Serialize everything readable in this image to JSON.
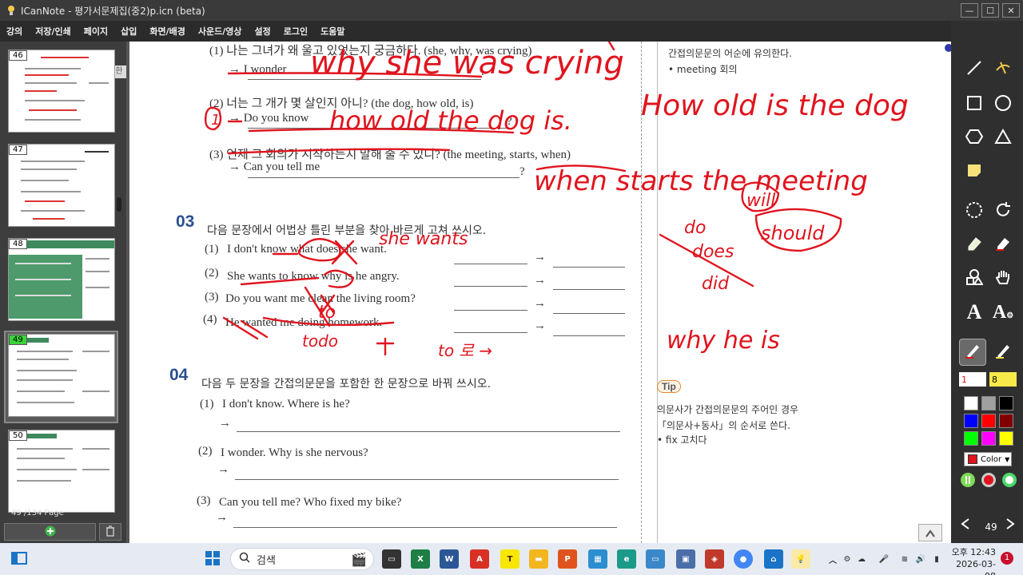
{
  "window": {
    "title": "ICanNote - 평가서문제집(중2)p.icn (beta)"
  },
  "menu": [
    "강의",
    "저장/인쇄",
    "페이지",
    "삽입",
    "화면/배경",
    "사운드/영상",
    "설정",
    "로그인",
    "도움말"
  ],
  "sidebar": {
    "thumbs": [
      {
        "num": "46"
      },
      {
        "num": "47"
      },
      {
        "num": "48"
      },
      {
        "num": "49",
        "current": true
      },
      {
        "num": "50"
      }
    ],
    "han_badge": "한",
    "page_count": "49 /134 Page"
  },
  "document": {
    "top": {
      "q1_korean": "(1) 나는 그녀가 왜 울고 있었는지 궁금하다. (she, why, was crying)",
      "q1_prompt": "→ I wonder",
      "q1_end": ".",
      "q2_korean": "(2) 너는 그 개가 몇 살인지 아니? (the dog, how old, is)",
      "q2_prompt": "→ Do you know",
      "q2_end": "?",
      "q3_korean": "(3) 언제 그 회의가 시작하는지 말해 줄 수 있니? (the meeting, starts, when)",
      "q3_prompt": "→ Can you tell me",
      "q3_end": "?"
    },
    "section03": {
      "num": "03",
      "instruction": "다음 문장에서 어법상 틀린 부분을 찾아 바르게 고쳐 쓰시오.",
      "items": [
        {
          "num": "(1)",
          "text": "I don't know what does she want."
        },
        {
          "num": "(2)",
          "text": "She wants to know why is he angry."
        },
        {
          "num": "(3)",
          "text": "Do you want me clean the living room?"
        },
        {
          "num": "(4)",
          "text": "He wanted me doing homework."
        }
      ],
      "arrow": "→"
    },
    "section04": {
      "num": "04",
      "instruction": "다음 두 문장을 간접의문문을 포함한 한 문장으로 바꿔 쓰시오.",
      "items": [
        {
          "num": "(1)",
          "text": "I don't know. Where is he?"
        },
        {
          "num": "(2)",
          "text": "I wonder. Why is she nervous?"
        },
        {
          "num": "(3)",
          "text": "Can you tell me? Who fixed my bike?"
        }
      ],
      "arrow": "→"
    },
    "side_notes": {
      "note1": "간접의문문의 어순에 유의한다.",
      "note2": "• meeting  회의",
      "tip_label": "Tip",
      "tip1": "의문사가 간접의문문의 주어인 경우",
      "tip2": "「의문사+동사」의 순서로 쓴다.",
      "tip3": "• fix  고치다"
    },
    "handwriting": {
      "a1": "why she was crying",
      "a2a": "how old the dog is.",
      "a2b": "How old is the dog",
      "a3": "when starts the meeting",
      "w1": "she wants",
      "w_do": "do",
      "w_does": "does",
      "w_did": "did",
      "w_will": "will",
      "w_should": "should",
      "w_to": "to",
      "w_todo": "todo",
      "w_towhy": "why he is",
      "w_toro": "to 로 →",
      "w_q1": "1"
    }
  },
  "toolbar": {
    "pen_size": "1",
    "marker_size": "8",
    "color_label": "Color",
    "page_number": "49"
  },
  "taskbar": {
    "search_placeholder": "검색",
    "clock_time": "오후 12:43",
    "clock_date": "2026-03-08",
    "notif_count": "1"
  },
  "colors": {
    "ink_red": "#e0141e",
    "title_blue": "#2b4f8f",
    "swatches": [
      "#ffffff",
      "#a0a0a0",
      "#000000",
      "#0000ff",
      "#ff0000",
      "#800000",
      "#00ff00",
      "#ff00ff",
      "#ffff00"
    ]
  }
}
